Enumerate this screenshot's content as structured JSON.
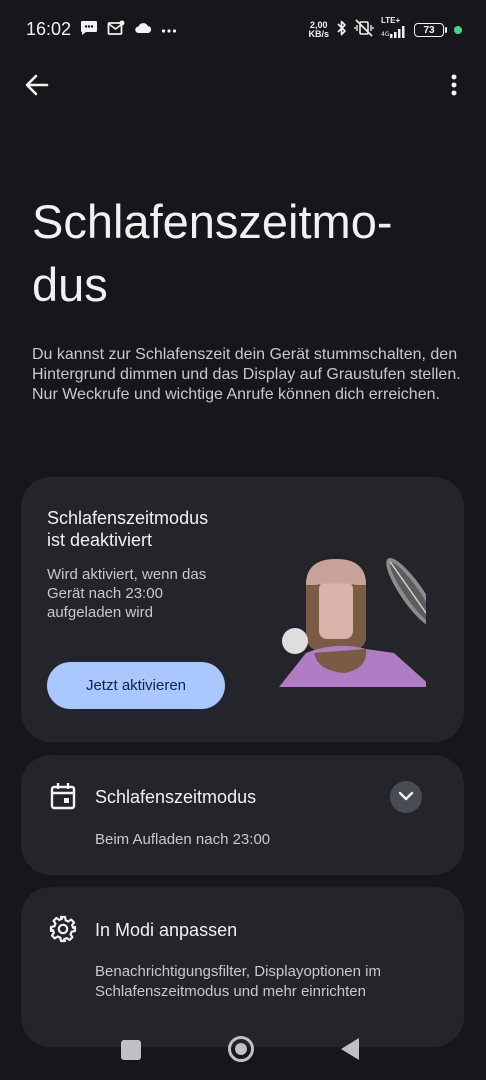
{
  "status_bar": {
    "time": "16:02",
    "net_speed_value": "2,00",
    "net_speed_unit": "KB/s",
    "network_type": "LTE+",
    "battery_level": "73",
    "left_icons": [
      "messages-icon",
      "mail-icon",
      "cloud-icon",
      "more-notifications-icon"
    ],
    "right_icons": [
      "bluetooth-icon",
      "vibrate-off-icon",
      "signal-icon",
      "battery-icon"
    ]
  },
  "top_bar": {
    "back_icon": "arrow-back-icon",
    "menu_icon": "more-vert-icon"
  },
  "page": {
    "title": "Schlafenszeitmo-\ndus",
    "description": "Du kannst zur Schlafenszeit dein Gerät stummschalten, den Hintergrund dimmen und das Display auf Graustufen stellen. Nur Weckrufe und wichtige Anrufe können dich erreichen."
  },
  "status_card": {
    "heading": "Schlafenszeitmodus\nist deaktiviert",
    "subtitle": "Wird aktiviert, wenn das\nGerät nach 23:00\naufgeladen wird",
    "button_label": "Jetzt aktivieren",
    "button_color": "#aac7ff"
  },
  "schedule_card": {
    "icon": "calendar-icon",
    "title": "Schlafenszeitmodus",
    "subtitle": "Beim Aufladen nach 23:00",
    "expand_icon": "chevron-down-icon"
  },
  "customize_card": {
    "icon": "gear-icon",
    "title": "In Modi anpassen",
    "subtitle": "Benachrichtigungsfilter, Displayoptionen im Schlafenszeitmodus und mehr einrichten"
  },
  "colors": {
    "background": "#16171b",
    "card": "#23252b",
    "accent": "#aac7ff",
    "battery_dot": "#3ddc84"
  }
}
